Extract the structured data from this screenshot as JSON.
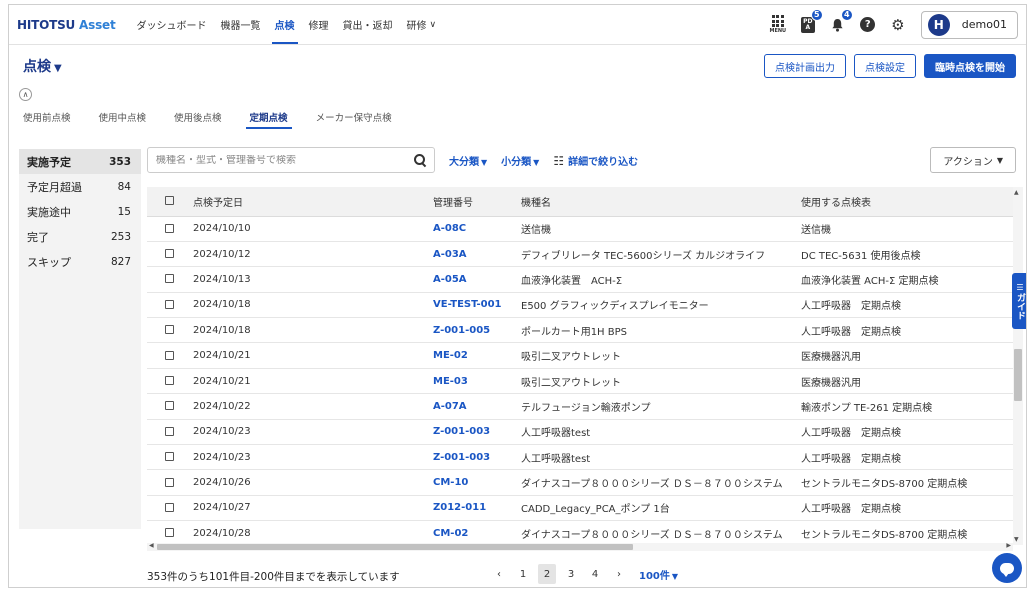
{
  "app": {
    "logo_main": "HITOTSU",
    "logo_sub": " Asset"
  },
  "nav": {
    "items": [
      {
        "label": "ダッシュボード"
      },
      {
        "label": "機器一覧"
      },
      {
        "label": "点検",
        "active": true
      },
      {
        "label": "修理"
      },
      {
        "label": "貸出・返却"
      },
      {
        "label": "研修"
      }
    ],
    "menu_label": "MENU",
    "pda_label": "PD\nA",
    "pda_badge": "5",
    "bell_badge": "4",
    "help_label": "?",
    "user_initial": "H",
    "username": "demo01"
  },
  "header": {
    "title": "点検",
    "btn_plan_output": "点検計画出力",
    "btn_settings": "点検設定",
    "btn_start": "臨時点検を開始"
  },
  "tabs": [
    {
      "label": "使用前点検"
    },
    {
      "label": "使用中点検"
    },
    {
      "label": "使用後点検"
    },
    {
      "label": "定期点検",
      "active": true
    },
    {
      "label": "メーカー保守点検"
    }
  ],
  "status_panel": [
    {
      "label": "実施予定",
      "count": "353",
      "active": true
    },
    {
      "label": "予定月超過",
      "count": "84"
    },
    {
      "label": "実施途中",
      "count": "15"
    },
    {
      "label": "完了",
      "count": "253"
    },
    {
      "label": "スキップ",
      "count": "827"
    }
  ],
  "toolbar": {
    "search_placeholder": "機種名・型式・管理番号で検索",
    "filter_major": "大分類",
    "filter_minor": "小分類",
    "filter_detail": "詳細で絞り込む",
    "action_label": "アクション"
  },
  "table": {
    "columns": [
      "点検予定日",
      "管理番号",
      "機種名",
      "使用する点検表"
    ],
    "rows": [
      {
        "date": "2024/10/10",
        "id": "A-08C",
        "model": "送信機",
        "sheet": "送信機"
      },
      {
        "date": "2024/10/12",
        "id": "A-03A",
        "model": "デフィブリレータ TEC-5600シリーズ カルジオライフ",
        "sheet": "DC TEC-5631 使用後点検"
      },
      {
        "date": "2024/10/13",
        "id": "A-05A",
        "model": "血液浄化装置　ACH-Σ",
        "sheet": "血液浄化装置 ACH-Σ 定期点検"
      },
      {
        "date": "2024/10/18",
        "id": "VE-TEST-001",
        "model": "E500 グラフィックディスプレイモニター",
        "sheet": "人工呼吸器　定期点検"
      },
      {
        "date": "2024/10/18",
        "id": "Z-001-005",
        "model": "ポールカート用1H BPS",
        "sheet": "人工呼吸器　定期点検"
      },
      {
        "date": "2024/10/21",
        "id": "ME-02",
        "model": "吸引二叉アウトレット",
        "sheet": "医療機器汎用"
      },
      {
        "date": "2024/10/21",
        "id": "ME-03",
        "model": "吸引二叉アウトレット",
        "sheet": "医療機器汎用"
      },
      {
        "date": "2024/10/22",
        "id": "A-07A",
        "model": "テルフュージョン輸液ポンプ",
        "sheet": "輸液ポンプ TE-261 定期点検"
      },
      {
        "date": "2024/10/23",
        "id": "Z-001-003",
        "model": "人工呼吸器test",
        "sheet": "人工呼吸器　定期点検"
      },
      {
        "date": "2024/10/23",
        "id": "Z-001-003",
        "model": "人工呼吸器test",
        "sheet": "人工呼吸器　定期点検"
      },
      {
        "date": "2024/10/26",
        "id": "CM-10",
        "model": "ダイナスコープ８０００シリーズ ＤＳ－８７００システム",
        "sheet": "セントラルモニタDS-8700 定期点検"
      },
      {
        "date": "2024/10/27",
        "id": "Z012-011",
        "model": "CADD_Legacy_PCA_ポンプ 1台",
        "sheet": "人工呼吸器　定期点検"
      },
      {
        "date": "2024/10/28",
        "id": "CM-02",
        "model": "ダイナスコープ８０００シリーズ ＤＳ－８７００システム",
        "sheet": "セントラルモニタDS-8700 定期点検"
      }
    ]
  },
  "footer": {
    "summary": "353件のうち101件目-200件目までを表示しています",
    "pages": [
      "1",
      "2",
      "3",
      "4"
    ],
    "current_page": "2",
    "per_page": "100件"
  },
  "guide_label": "ガイド",
  "colors": {
    "primary": "#1a56c4",
    "navy": "#1d3a8a"
  }
}
